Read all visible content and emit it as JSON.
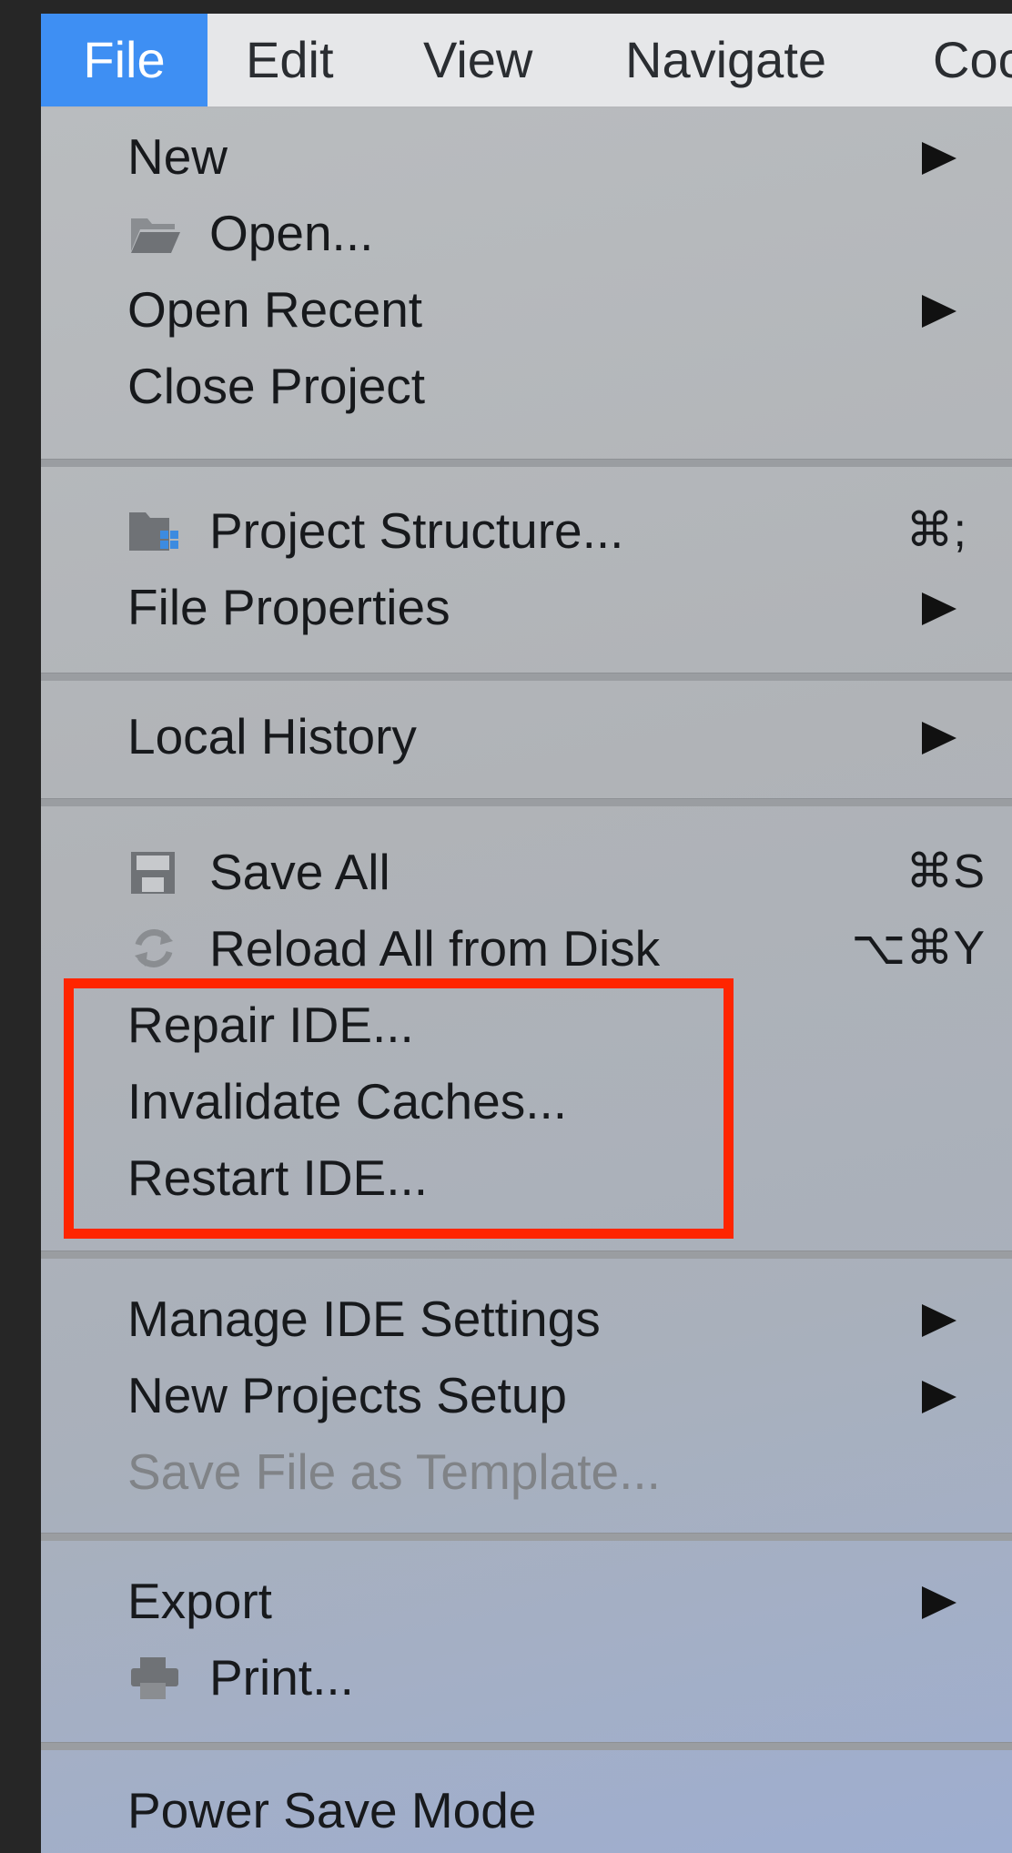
{
  "menubar": {
    "items": [
      "File",
      "Edit",
      "View",
      "Navigate",
      "Coc"
    ]
  },
  "menu": {
    "new": {
      "label": "New",
      "icon": "chevron-right-icon"
    },
    "open": {
      "label": "Open...",
      "icon": "folder-open-icon"
    },
    "open_recent": {
      "label": "Open Recent",
      "icon": "chevron-right-icon"
    },
    "close_project": {
      "label": "Close Project"
    },
    "project_structure": {
      "label": "Project Structure...",
      "shortcut": "⌘;",
      "icon": "project-structure-icon"
    },
    "file_properties": {
      "label": "File Properties",
      "icon": "chevron-right-icon"
    },
    "local_history": {
      "label": "Local History",
      "icon": "chevron-right-icon"
    },
    "save_all": {
      "label": "Save All",
      "shortcut": "⌘S",
      "icon": "save-icon"
    },
    "reload_all": {
      "label": "Reload All from Disk",
      "shortcut": "⌥⌘Y",
      "icon": "reload-icon"
    },
    "repair_ide": {
      "label": "Repair IDE..."
    },
    "invalidate_caches": {
      "label": "Invalidate Caches..."
    },
    "restart_ide": {
      "label": "Restart IDE..."
    },
    "manage_ide_settings": {
      "label": "Manage IDE Settings",
      "icon": "chevron-right-icon"
    },
    "new_projects_setup": {
      "label": "New Projects Setup",
      "icon": "chevron-right-icon"
    },
    "save_file_as_template": {
      "label": "Save File as Template...",
      "disabled": true
    },
    "export": {
      "label": "Export",
      "icon": "chevron-right-icon"
    },
    "print": {
      "label": "Print...",
      "icon": "printer-icon"
    },
    "power_save_mode": {
      "label": "Power Save Mode"
    }
  },
  "colors": {
    "menubar_active": "#3e8ff3",
    "highlight_box": "#ff2500"
  }
}
